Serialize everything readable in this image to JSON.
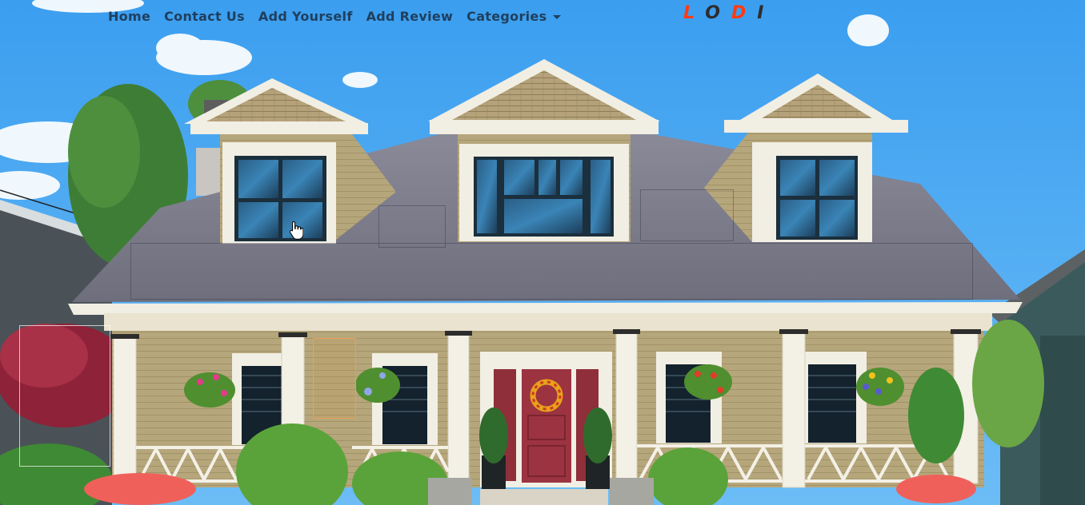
{
  "nav": {
    "home": "Home",
    "contact": "Contact Us",
    "add_yourself": "Add Yourself",
    "add_review": "Add Review",
    "categories": "Categories"
  },
  "logo": {
    "letters": [
      "L",
      "O",
      "D",
      "I"
    ]
  },
  "colors": {
    "sky": "#4aa9f3",
    "nav_text": "#1f3f5e",
    "logo_red": "#ff3b14",
    "logo_dark": "#2d2d2d",
    "roof": "#7f7f8c",
    "siding": "#b7a77c",
    "trim": "#f1eee3",
    "door": "#9b3340"
  },
  "icons": {
    "cursor": "hand-pointer-icon",
    "dropdown": "chevron-down-icon"
  }
}
